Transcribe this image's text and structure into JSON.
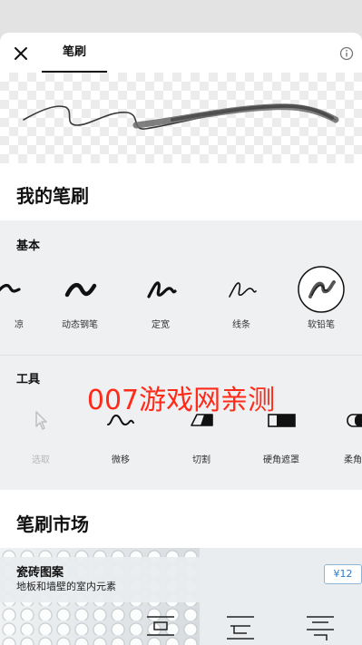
{
  "header": {
    "tab_label": "笔刷",
    "accent": "#111111"
  },
  "icons": {
    "close": "close-icon",
    "info": "info-icon"
  },
  "my_brushes": {
    "title": "我的笔刷",
    "basic": {
      "label": "基本",
      "items": [
        {
          "label": "凉",
          "icon": "partial-brush-icon"
        },
        {
          "label": "动态钢笔",
          "icon": "dynamic-pen-icon"
        },
        {
          "label": "定宽",
          "icon": "fixed-width-icon"
        },
        {
          "label": "线条",
          "icon": "line-icon"
        },
        {
          "label": "软铅笔",
          "icon": "soft-pencil-icon",
          "selected": true
        }
      ]
    },
    "tools": {
      "label": "工具",
      "items": [
        {
          "label": "选取",
          "icon": "select-cursor-icon",
          "disabled": true
        },
        {
          "label": "微移",
          "icon": "nudge-wave-icon"
        },
        {
          "label": "切割",
          "icon": "cut-icon"
        },
        {
          "label": "硬角遮罩",
          "icon": "hard-mask-icon"
        },
        {
          "label": "柔角",
          "icon": "soft-mask-icon"
        }
      ]
    }
  },
  "watermark": {
    "text": "007游戏网亲测",
    "color": "#ff2a1a"
  },
  "market": {
    "title": "笔刷市场",
    "card": {
      "title": "瓷砖图案",
      "subtitle": "地板和墙壁的室内元素",
      "price": "¥12",
      "price_color": "#2f79c2"
    }
  }
}
